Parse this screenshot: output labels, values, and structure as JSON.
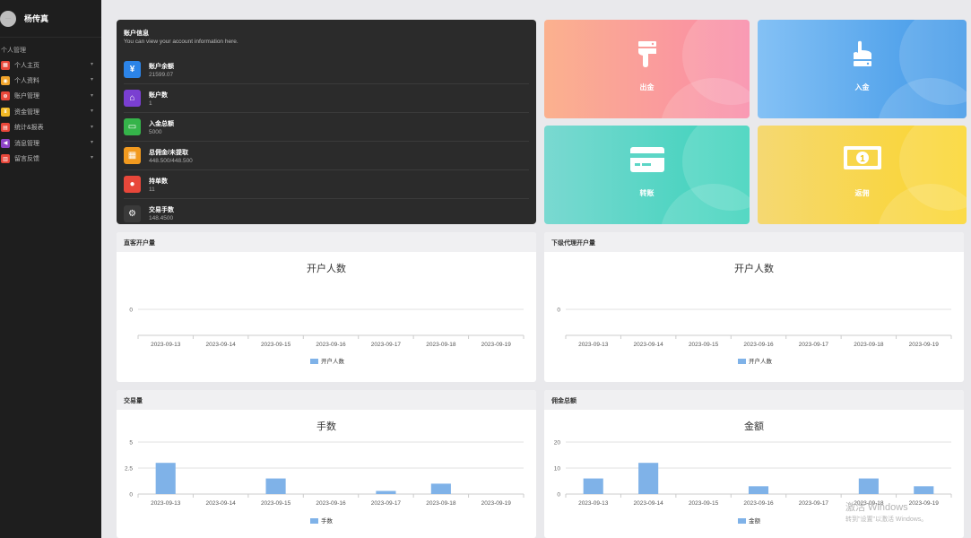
{
  "sidebar": {
    "user_name": "杨传真",
    "group_label": "个人管理",
    "items": [
      {
        "label": "个人主页",
        "icon": "home-icon",
        "color": "#e8473a"
      },
      {
        "label": "个人资料",
        "icon": "profile-icon",
        "color": "#f2a42b"
      },
      {
        "label": "账户管理",
        "icon": "account-icon",
        "color": "#e8473a"
      },
      {
        "label": "资金管理",
        "icon": "fund-icon",
        "color": "#f2b824"
      },
      {
        "label": "统计&报表",
        "icon": "report-icon",
        "color": "#e8473a"
      },
      {
        "label": "消息管理",
        "icon": "message-icon",
        "color": "#8e44c9"
      },
      {
        "label": "留言反馈",
        "icon": "feedback-icon",
        "color": "#e8473a"
      }
    ]
  },
  "account": {
    "title": "账户信息",
    "subtitle": "You can view your account information here.",
    "rows": [
      {
        "label": "账户余额",
        "value": "21599.07",
        "icon": "yen-icon",
        "color": "#2c84e8"
      },
      {
        "label": "账户数",
        "value": "1",
        "icon": "store-icon",
        "color": "#7a3fd1"
      },
      {
        "label": "入金总额",
        "value": "5000",
        "icon": "card-icon",
        "color": "#35b44a"
      },
      {
        "label": "总佣金/未提取",
        "value": "448.500/448.500",
        "icon": "grid-icon",
        "color": "#f29a1f"
      },
      {
        "label": "持单数",
        "value": "11",
        "icon": "chat-icon",
        "color": "#e8473a"
      },
      {
        "label": "交易手数",
        "value": "148.4500",
        "icon": "gear-icon",
        "color": "#3a3a3a"
      }
    ]
  },
  "tiles": {
    "withdraw": "出金",
    "deposit": "入金",
    "transfer": "转账",
    "rebate": "返佣"
  },
  "cards": {
    "direct": "直客开户量",
    "agent": "下级代理开户量",
    "volume": "交易量",
    "commission": "佣金总额"
  },
  "chart_data": [
    {
      "type": "bar",
      "title": "开户人数",
      "categories": [
        "2023-09-13",
        "2023-09-14",
        "2023-09-15",
        "2023-09-16",
        "2023-09-17",
        "2023-09-18",
        "2023-09-19"
      ],
      "series": [
        {
          "name": "开户人数",
          "values": [
            0,
            0,
            0,
            0,
            0,
            0,
            0
          ]
        }
      ],
      "ylim": [
        0,
        0
      ],
      "yticks": [
        "0"
      ]
    },
    {
      "type": "bar",
      "title": "开户人数",
      "categories": [
        "2023-09-13",
        "2023-09-14",
        "2023-09-15",
        "2023-09-16",
        "2023-09-17",
        "2023-09-18",
        "2023-09-19"
      ],
      "series": [
        {
          "name": "开户人数",
          "values": [
            0,
            0,
            0,
            0,
            0,
            0,
            0
          ]
        }
      ],
      "ylim": [
        0,
        0
      ],
      "yticks": [
        "0"
      ]
    },
    {
      "type": "bar",
      "title": "手数",
      "categories": [
        "2023-09-13",
        "2023-09-14",
        "2023-09-15",
        "2023-09-16",
        "2023-09-17",
        "2023-09-18",
        "2023-09-19"
      ],
      "series": [
        {
          "name": "手数",
          "values": [
            3,
            0,
            1.5,
            0,
            0.3,
            1,
            0
          ]
        }
      ],
      "ylim": [
        0,
        5
      ],
      "yticks": [
        "0",
        "2.5",
        "5"
      ]
    },
    {
      "type": "bar",
      "title": "金额",
      "categories": [
        "2023-09-13",
        "2023-09-14",
        "2023-09-15",
        "2023-09-16",
        "2023-09-17",
        "2023-09-18",
        "2023-09-19"
      ],
      "series": [
        {
          "name": "金额",
          "values": [
            6,
            12,
            0,
            3,
            0,
            6,
            3
          ]
        }
      ],
      "ylim": [
        0,
        20
      ],
      "yticks": [
        "0",
        "10",
        "20"
      ]
    }
  ],
  "bar_color": "#7fb2e8",
  "watermark": {
    "line1": "激活 Windows",
    "line2": "转到\"设置\"以激活 Windows。"
  }
}
